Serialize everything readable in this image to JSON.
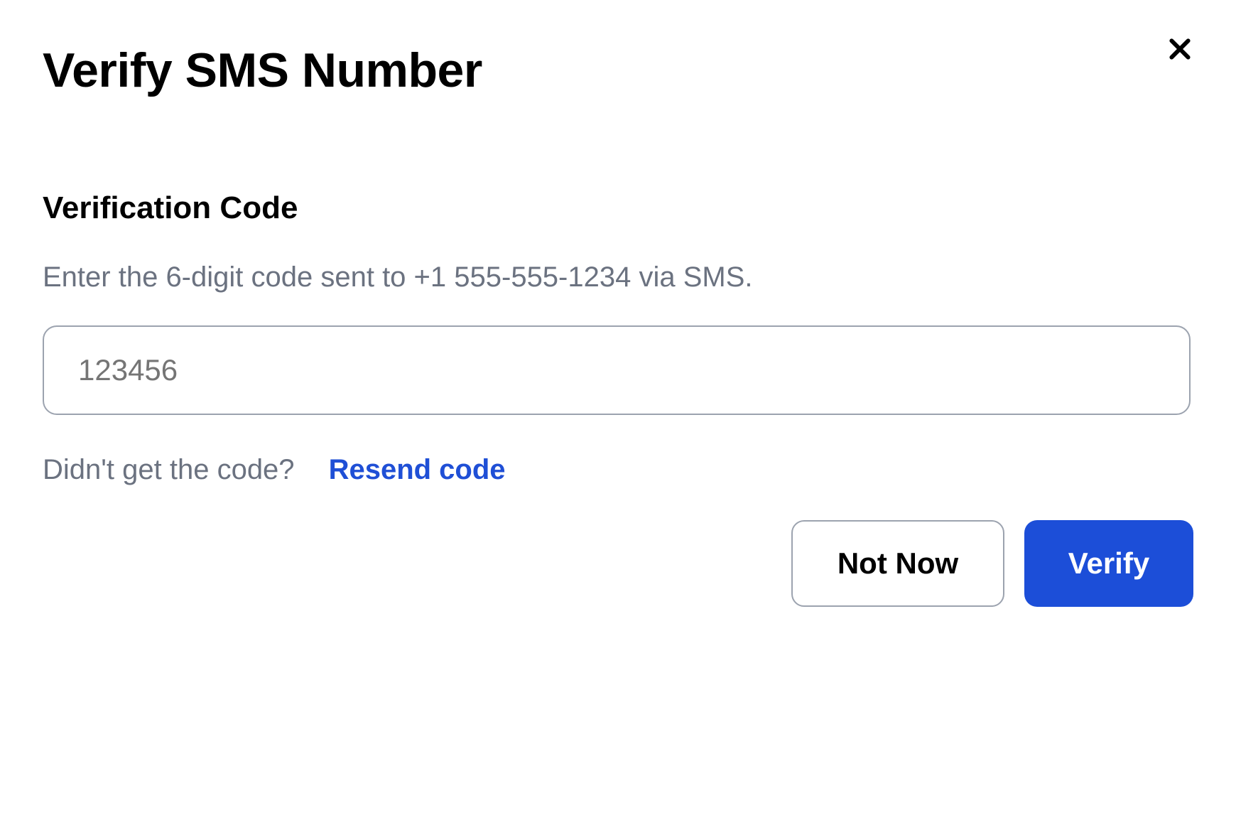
{
  "modal": {
    "title": "Verify SMS Number",
    "close_icon": "close-icon"
  },
  "form": {
    "label": "Verification Code",
    "instruction": "Enter the 6-digit code sent to +1 555-555-1234 via SMS.",
    "input_placeholder": "123456",
    "resend_prompt": "Didn't get the code?",
    "resend_link": "Resend code"
  },
  "buttons": {
    "secondary": "Not Now",
    "primary": "Verify"
  },
  "colors": {
    "link": "#1f4fd6",
    "primary_button": "#1c4ed8",
    "muted_text": "#6b7280",
    "border": "#9ca3af"
  }
}
